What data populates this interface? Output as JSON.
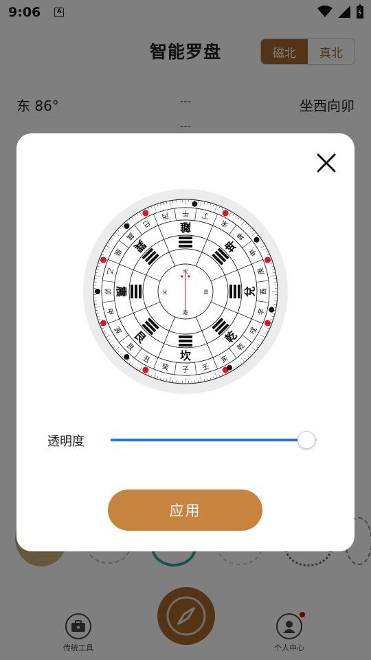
{
  "status": {
    "time": "9:06",
    "notif_glyph": "A"
  },
  "header": {
    "title": "智能罗盘",
    "north_options": [
      {
        "label": "磁北",
        "active": true
      },
      {
        "label": "真北",
        "active": false
      }
    ]
  },
  "info": {
    "direction": "东 86°",
    "mid_top": "---",
    "mid_bottom": "---",
    "seat": "坐西向卯"
  },
  "bottom_nav": {
    "tools_label": "传统工具",
    "profile_label": "个人中心"
  },
  "dialog": {
    "opacity_label": "透明度",
    "opacity_value": 0.95,
    "apply_label": "应用"
  },
  "compass": {
    "trigrams": [
      "坎",
      "艮",
      "震",
      "巽",
      "離",
      "坤",
      "兌",
      "乾"
    ],
    "mountains": [
      "子",
      "癸",
      "丑",
      "艮",
      "寅",
      "甲",
      "卯",
      "乙",
      "辰",
      "巽",
      "巳",
      "丙",
      "午",
      "丁",
      "未",
      "坤",
      "申",
      "庚",
      "酉",
      "辛",
      "戌",
      "乾",
      "亥",
      "壬"
    ],
    "center_labels": [
      "坎",
      "震",
      "離",
      "兌"
    ]
  },
  "colors": {
    "accent": "#a8692e",
    "apply": "#c7843e",
    "slider": "#2870e6",
    "red_dot": "#e0161d"
  }
}
